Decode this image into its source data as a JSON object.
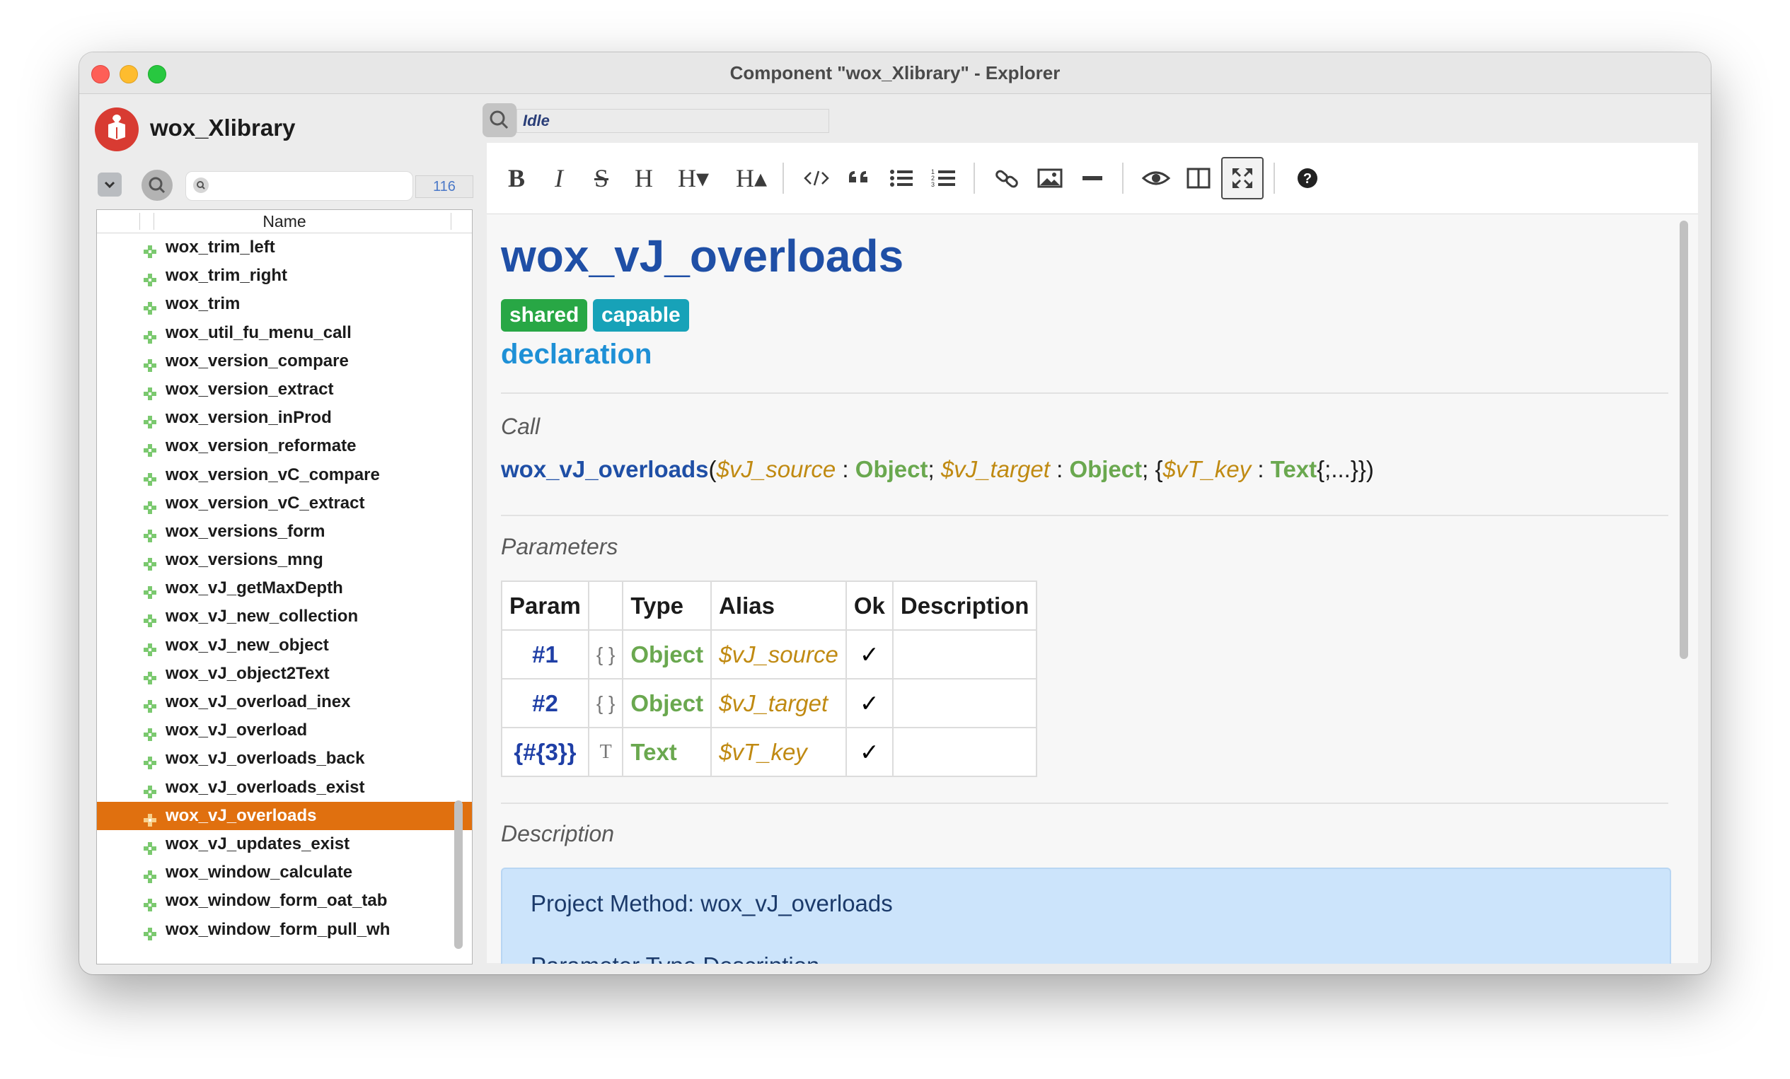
{
  "window": {
    "title": "Component \"wox_Xlibrary\" - Explorer"
  },
  "sidebar": {
    "app_name": "wox_Xlibrary",
    "search_placeholder": "",
    "count": "116",
    "column_header": "Name",
    "items": [
      {
        "label": "wox_trim_left",
        "selected": false
      },
      {
        "label": "wox_trim_right",
        "selected": false
      },
      {
        "label": "wox_trim",
        "selected": false
      },
      {
        "label": "wox_util_fu_menu_call",
        "selected": false
      },
      {
        "label": "wox_version_compare",
        "selected": false
      },
      {
        "label": "wox_version_extract",
        "selected": false
      },
      {
        "label": "wox_version_inProd",
        "selected": false
      },
      {
        "label": "wox_version_reformate",
        "selected": false
      },
      {
        "label": "wox_version_vC_compare",
        "selected": false
      },
      {
        "label": "wox_version_vC_extract",
        "selected": false
      },
      {
        "label": "wox_versions_form",
        "selected": false
      },
      {
        "label": "wox_versions_mng",
        "selected": false
      },
      {
        "label": "wox_vJ_getMaxDepth",
        "selected": false
      },
      {
        "label": "wox_vJ_new_collection",
        "selected": false
      },
      {
        "label": "wox_vJ_new_object",
        "selected": false
      },
      {
        "label": "wox_vJ_object2Text",
        "selected": false
      },
      {
        "label": "wox_vJ_overload_inex",
        "selected": false
      },
      {
        "label": "wox_vJ_overload",
        "selected": false
      },
      {
        "label": "wox_vJ_overloads_back",
        "selected": false
      },
      {
        "label": "wox_vJ_overloads_exist",
        "selected": false
      },
      {
        "label": "wox_vJ_overloads",
        "selected": true
      },
      {
        "label": "wox_vJ_updates_exist",
        "selected": false
      },
      {
        "label": "wox_window_calculate",
        "selected": false
      },
      {
        "label": "wox_window_form_oat_tab",
        "selected": false
      },
      {
        "label": "wox_window_form_pull_wh",
        "selected": false
      }
    ]
  },
  "status": {
    "text": "Idle"
  },
  "toolbar": {
    "icons": [
      "bold-icon",
      "italic-icon",
      "strikethrough-icon",
      "heading-icon",
      "heading-smaller-icon",
      "heading-bigger-icon",
      "code-icon",
      "quote-icon",
      "unordered-list-icon",
      "ordered-list-icon",
      "link-icon",
      "image-icon",
      "horizontal-rule-icon",
      "preview-icon",
      "side-by-side-icon",
      "fullscreen-icon",
      "help-icon"
    ],
    "bold": "B",
    "italic": "I",
    "strike": "S",
    "heading": "H",
    "heading_smaller": "H▾",
    "heading_bigger": "H▴"
  },
  "doc": {
    "title": "wox_vJ_overloads",
    "badges": [
      "shared",
      "capable"
    ],
    "declaration": "declaration",
    "call_heading": "Call",
    "call": {
      "fn": "wox_vJ_overloads",
      "p1": "$vJ_source",
      "t1": "Object",
      "p2": "$vJ_target",
      "t2": "Object",
      "p3": "$vT_key",
      "t3": "Text",
      "open": "(",
      "sep1": " : ",
      "semi": "; ",
      "brace_open": "{",
      "tail": "{;...}})"
    },
    "params_heading": "Parameters",
    "params_table": {
      "headers": [
        "Param",
        "",
        "Type",
        "Alias",
        "Ok",
        "Description"
      ],
      "rows": [
        {
          "param": "#1",
          "icon": "{ }",
          "type": "Object",
          "alias": "$vJ_source",
          "ok": "✓",
          "desc": ""
        },
        {
          "param": "#2",
          "icon": "{ }",
          "type": "Object",
          "alias": "$vJ_target",
          "ok": "✓",
          "desc": ""
        },
        {
          "param": "{#{3}}",
          "icon": "T",
          "type": "Text",
          "alias": "$vT_key",
          "ok": "✓",
          "desc": ""
        }
      ]
    },
    "description_heading": "Description",
    "description_line1": "Project Method: wox_vJ_overloads",
    "description_line2": "Parameter  Type  Description"
  },
  "colors": {
    "selection": "#e0700f",
    "title_blue": "#1f4fa6",
    "badge_shared": "#28a745",
    "badge_capable": "#17a2b8",
    "declaration": "#1e90d6"
  }
}
